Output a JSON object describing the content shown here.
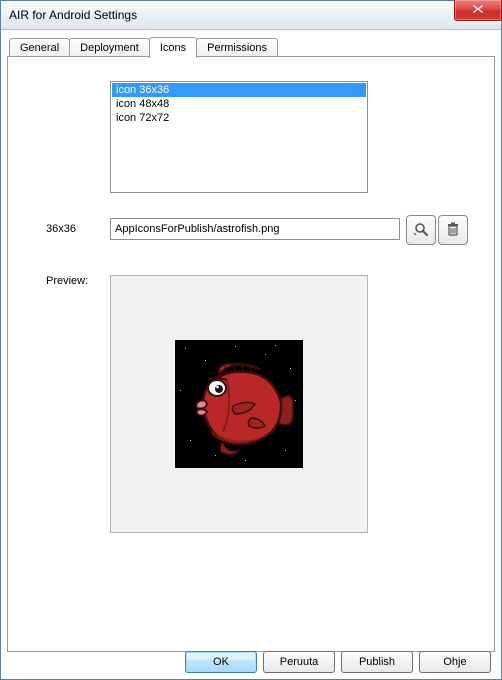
{
  "window": {
    "title": "AIR for Android Settings"
  },
  "tabs": [
    {
      "label": "General"
    },
    {
      "label": "Deployment"
    },
    {
      "label": "Icons"
    },
    {
      "label": "Permissions"
    }
  ],
  "active_tab_index": 2,
  "icon_list": {
    "items": [
      {
        "label": "icon 36x36"
      },
      {
        "label": "icon 48x48"
      },
      {
        "label": "icon 72x72"
      }
    ],
    "selected_index": 0
  },
  "size_label": "36x36",
  "path_input": {
    "value": "AppIconsForPublish/astrofish.png"
  },
  "preview_label": "Preview:",
  "buttons": {
    "ok": "OK",
    "cancel": "Peruuta",
    "publish": "Publish",
    "help": "Ohje"
  },
  "icons": {
    "browse": "browse-icon",
    "trash": "trash-icon",
    "close": "close-icon"
  }
}
